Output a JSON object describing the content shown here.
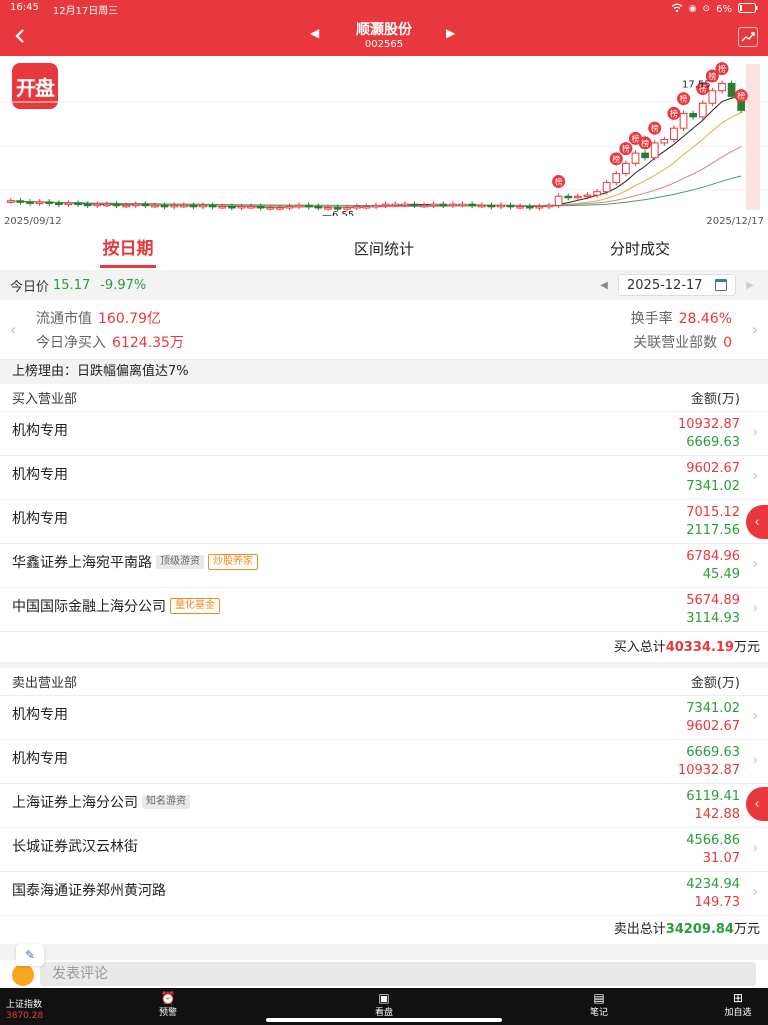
{
  "status_bar": {
    "time": "16:45",
    "date": "12月17日周三",
    "battery": "6%",
    "icons": [
      "wifi-icon",
      "lock-icon",
      "alarm-icon",
      "battery-icon"
    ]
  },
  "nav": {
    "title": "顺灏股份",
    "code": "002565",
    "back_icon": "chevron-left-icon",
    "prev_icon": "triangle-left-icon",
    "next_icon": "triangle-right-icon",
    "switch_icon": "chart-switch-icon"
  },
  "chart": {
    "logo_text": "开盘",
    "start_date": "2025/09/12",
    "end_date": "2025/12/17",
    "high_label": "17.55",
    "low_label": "6.55",
    "badge_text": "榜",
    "colors": {
      "up": "#e8383d",
      "down": "#2a7d2e",
      "ma5": "#222222",
      "ma10": "#e0b23a",
      "ma20": "#e07b91",
      "ma60": "#3aa76d"
    }
  },
  "chart_data": {
    "type": "candlestick",
    "title": "",
    "x_range": [
      "2025/09/12",
      "2025/12/17"
    ],
    "annotations": [
      "17.55",
      "6.55"
    ],
    "marker_label": "榜",
    "series_close_approx": [
      7.2,
      7.1,
      7.0,
      7.1,
      7.0,
      6.9,
      7.0,
      6.9,
      6.8,
      6.9,
      6.9,
      6.8,
      6.8,
      6.9,
      6.8,
      6.8,
      6.7,
      6.8,
      6.8,
      6.7,
      6.8,
      6.7,
      6.7,
      6.6,
      6.7,
      6.7,
      6.6,
      6.6,
      6.6,
      6.7,
      6.8,
      6.7,
      6.6,
      6.6,
      6.55,
      6.6,
      6.7,
      6.7,
      6.8,
      6.9,
      6.9,
      6.9,
      6.8,
      6.8,
      6.9,
      6.8,
      6.9,
      6.9,
      6.8,
      6.8,
      6.7,
      6.8,
      6.7,
      6.7,
      6.6,
      6.7,
      6.8,
      7.6,
      7.5,
      7.6,
      7.7,
      8.0,
      8.8,
      9.6,
      10.5,
      11.4,
      11.0,
      12.3,
      12.6,
      13.6,
      14.9,
      14.6,
      15.8,
      16.9,
      17.55,
      16.4,
      15.17
    ]
  },
  "tabs": [
    {
      "label": "按日期",
      "active": true
    },
    {
      "label": "区间统计",
      "active": false
    },
    {
      "label": "分时成交",
      "active": false
    }
  ],
  "price_row": {
    "label": "今日价",
    "price": "15.17",
    "change": "-9.97%",
    "date": "2025-12-17"
  },
  "summary": {
    "float_mv_label": "流通市值",
    "float_mv": "160.79亿",
    "net_buy_label": "今日净买入",
    "net_buy": "6124.35万",
    "turnover_label": "换手率",
    "turnover": "28.46%",
    "related_label": "关联营业部数",
    "related": "0"
  },
  "reason": "上榜理由：日跌幅偏离值达7%",
  "buy": {
    "header": "买入营业部",
    "amount_header": "金额(万)",
    "rows": [
      {
        "name": "机构专用",
        "tags": [],
        "buy": "10932.87",
        "sell": "6669.63"
      },
      {
        "name": "机构专用",
        "tags": [],
        "buy": "9602.67",
        "sell": "7341.02"
      },
      {
        "name": "机构专用",
        "tags": [],
        "buy": "7015.12",
        "sell": "2117.56"
      },
      {
        "name": "华鑫证券上海宛平南路",
        "tags": [
          {
            "text": "顶级游资",
            "style": "gray"
          },
          {
            "text": "炒股养家",
            "style": "orange"
          }
        ],
        "buy": "6784.96",
        "sell": "45.49"
      },
      {
        "name": "中国国际金融上海分公司",
        "tags": [
          {
            "text": "量化基金",
            "style": "orange"
          }
        ],
        "buy": "5674.89",
        "sell": "3114.93"
      }
    ],
    "total_label": "买入总计",
    "total_value": "40334.19",
    "total_unit": "万元"
  },
  "sell": {
    "header": "卖出营业部",
    "amount_header": "金额(万)",
    "rows": [
      {
        "name": "机构专用",
        "tags": [],
        "sell": "7341.02",
        "buy": "9602.67"
      },
      {
        "name": "机构专用",
        "tags": [],
        "sell": "6669.63",
        "buy": "10932.87"
      },
      {
        "name": "上海证券上海分公司",
        "tags": [
          {
            "text": "知名游资",
            "style": "gray"
          }
        ],
        "sell": "6119.41",
        "buy": "142.88"
      },
      {
        "name": "长城证券武汉云林街",
        "tags": [],
        "sell": "4566.86",
        "buy": "31.07"
      },
      {
        "name": "国泰海通证券郑州黄河路",
        "tags": [],
        "sell": "4234.94",
        "buy": "149.73"
      }
    ],
    "total_label": "卖出总计",
    "total_value": "34209.84",
    "total_unit": "万元"
  },
  "comment": {
    "placeholder": "发表评论"
  },
  "bottom_bar": {
    "index_name": "上证指数",
    "index_value": "3870.28",
    "items": [
      {
        "label": "预警",
        "icon": "alarm-clock-icon"
      },
      {
        "label": "看盘",
        "icon": "monitor-icon"
      },
      {
        "label": "笔记",
        "icon": "note-icon"
      },
      {
        "label": "加自选",
        "icon": "plus-square-icon"
      }
    ]
  }
}
